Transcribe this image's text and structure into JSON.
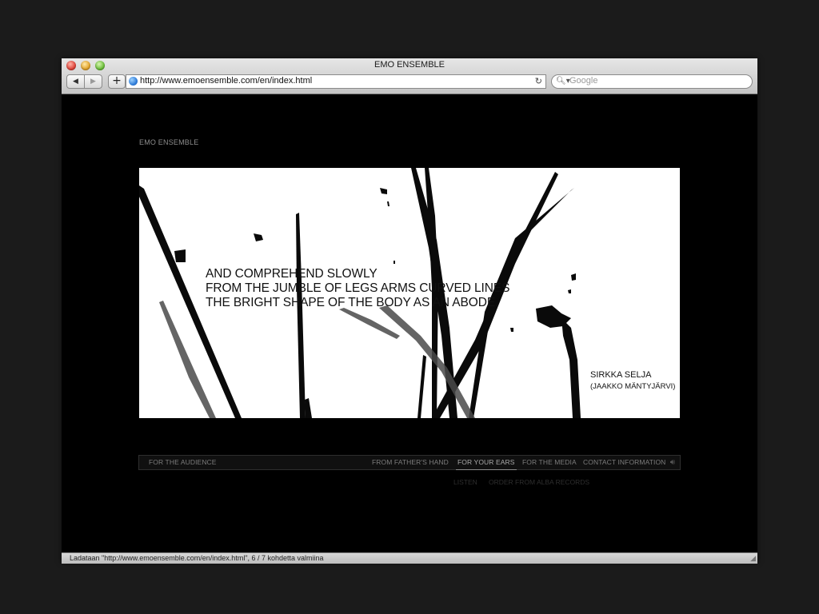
{
  "browser": {
    "window_title": "EMO ENSEMBLE",
    "back_label": "◀",
    "forward_label": "▶",
    "add_label": "+",
    "url": "http://www.emoensemble.com/en/index.html",
    "reload_label": "↻",
    "search_placeholder": "Google",
    "status": "Ladataan \"http://www.emoensemble.com/en/index.html\", 6 / 7 kohdetta valmiina"
  },
  "page": {
    "brand": "EMO ENSEMBLE",
    "hero": {
      "quote_lines": [
        "AND COMPREHEND SLOWLY",
        "FROM THE JUMBLE OF LEGS ARMS CURVED LINES",
        "THE BRIGHT SHAPE OF THE BODY AS AN ABODE."
      ],
      "author": "SIRKKA SELJA",
      "translator": "(JAAKKO MÄNTYJÄRVI)"
    },
    "nav": {
      "left_item": "FOR THE AUDIENCE",
      "items": [
        {
          "label": "FROM FATHER'S HAND",
          "active": false
        },
        {
          "label": "FOR YOUR EARS",
          "active": true
        },
        {
          "label": "FOR THE MEDIA",
          "active": false
        },
        {
          "label": "CONTACT INFORMATION",
          "active": false
        }
      ]
    },
    "subnav": [
      "LISTEN",
      "ORDER FROM ALBA RECORDS"
    ]
  },
  "icons": {
    "speaker": "speaker-icon",
    "search": "search-icon",
    "globe": "globe-icon",
    "reload": "reload-icon"
  },
  "colors": {
    "page_background": "#000000",
    "hero_background": "#ffffff",
    "nav_text": "#7c7c7c",
    "nav_active": "#a9a9a9"
  }
}
